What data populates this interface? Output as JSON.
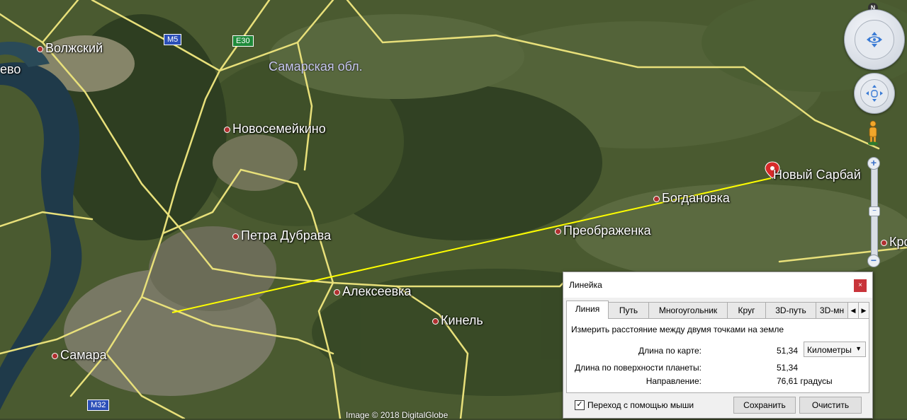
{
  "map": {
    "places": [
      {
        "name": "Волжский"
      },
      {
        "name": "ево"
      },
      {
        "name": "Новосемейкино"
      },
      {
        "name": "Петра Дубрава"
      },
      {
        "name": "Алексеевка"
      },
      {
        "name": "Кинель"
      },
      {
        "name": "Самара"
      },
      {
        "name": "Богдановка"
      },
      {
        "name": "Преображенка"
      },
      {
        "name": "Новый Сарбай"
      },
      {
        "name": "Кро"
      }
    ],
    "region_label": "Самарская обл.",
    "road_shields": [
      {
        "label": "M5",
        "color": "#2b4fb8"
      },
      {
        "label": "E30",
        "color": "#1f8a3a"
      },
      {
        "label": "M32",
        "color": "#2b4fb8"
      }
    ],
    "credit": "Image © 2018 DigitalGlobe",
    "measure_line_color": "#ffff00",
    "road_color": "#e8e07a"
  },
  "nav": {
    "north": "N",
    "zoom_in": "+",
    "zoom_out": "−"
  },
  "dialog": {
    "title": "Линейка",
    "close": "×",
    "tabs": [
      "Линия",
      "Путь",
      "Многоугольник",
      "Круг",
      "3D-путь",
      "3D-мн"
    ],
    "active_tab": "Линия",
    "description": "Измерить расстояние между двумя точками на земле",
    "map_length_label": "Длина по карте:",
    "map_length_value": "51,34",
    "unit_selected": "Километры",
    "surface_length_label": "Длина по поверхности планеты:",
    "surface_length_value": "51,34",
    "direction_label": "Направление:",
    "direction_value": "76,61 градусы",
    "mouse_nav_label": "Переход с помощью мыши",
    "mouse_nav_checked": true,
    "save_label": "Сохранить",
    "clear_label": "Очистить"
  }
}
